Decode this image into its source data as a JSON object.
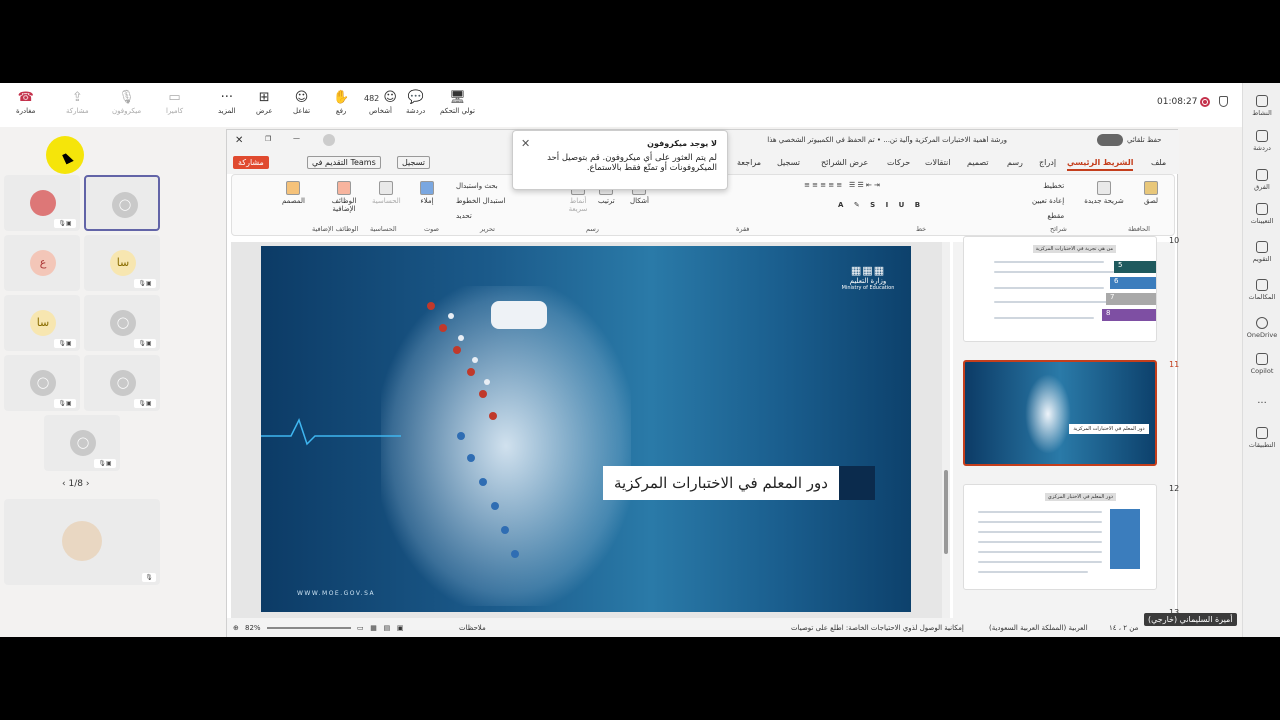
{
  "teams": {
    "toolbar": {
      "leave": "مغادرة",
      "share": "مشاركة",
      "mic": "ميكروفون",
      "camera": "كاميرا",
      "more": "المزيد",
      "view": "عرض",
      "react": "تفاعل",
      "raise": "رفع",
      "people_count": "482",
      "people": "أشخاص",
      "chat": "دردشة",
      "take_control": "تولي التحكم",
      "timer": "01:08:27"
    },
    "rail": [
      "النشاط",
      "دردشة",
      "الفرق",
      "التعيينات",
      "التقويم",
      "المكالمات",
      "OneDrive",
      "Copilot",
      "...",
      "التطبيقات"
    ],
    "participants": [
      {
        "initials": "",
        "mic": "🎙▣"
      },
      {
        "initials": "",
        "mic": ""
      },
      {
        "initials": "ع",
        "mic": ""
      },
      {
        "initials": "سا",
        "mic": "🎙▣"
      },
      {
        "initials": "سا",
        "mic": "🎙▣"
      },
      {
        "initials": "",
        "mic": "🎙▣"
      },
      {
        "initials": "",
        "mic": "🎙▣"
      },
      {
        "initials": "",
        "mic": "🎙▣"
      },
      {
        "initials": "",
        "mic": "🎙▣"
      }
    ],
    "pager": "1/8",
    "presenter_name": "أميرة السليماني (خارجي)"
  },
  "ppt": {
    "title": "ورشة أهمية الاختبارات المركزية وآلية تن... • تم الحفظ في الكمبيوتر الشخصي هذا",
    "autosave": "حفظ تلقائي",
    "tabs": [
      "ملف",
      "الشريط الرئيسي",
      "إدراج",
      "رسم",
      "تصميم",
      "انتقالات",
      "حركات",
      "عرض الشرائح",
      "تسجيل",
      "مراجعة"
    ],
    "record_btn": "تسجيل",
    "present_teams": "التقديم في Teams",
    "share_btn": "مشاركة",
    "ribbon": {
      "paste": "لصق",
      "clipboard": "الحافظة",
      "new_slide": "شريحة جديدة",
      "layout": "تخطيط",
      "reset": "إعادة تعيين",
      "section": "مقطع",
      "slides": "شرائح",
      "font": "خط",
      "paragraph": "فقرة",
      "shapes": "أشكال",
      "arrange": "ترتيب",
      "quick_styles": "أنماط سريعة",
      "drawing": "رسم",
      "find": "بحث واستبدال",
      "replace_fonts": "استبدال الخطوط",
      "select": "تحديد",
      "editing": "تحرير",
      "dictate": "إملاء",
      "voice": "صوت",
      "sensitivity": "الحساسية",
      "addins": "الوظائف الإضافية",
      "designer": "المصمم"
    },
    "slide": {
      "title": "دور المعلم في الاختبارات المركزية",
      "ministry_ar": "وزارة التعليم",
      "ministry_en": "Ministry of Education",
      "url": "WWW.MOE.GOV.SA"
    },
    "thumbs": [
      {
        "num": "10",
        "title": "من هي تجربة في الاختبارات المركزية"
      },
      {
        "num": "11",
        "title": "دور المعلم في الاختبارات المركزية"
      },
      {
        "num": "12",
        "title": "دور المعلم في الاختبار المركزي"
      },
      {
        "num": "13",
        "title": ""
      }
    ],
    "status": {
      "slide_num": "من ٢ ، ١٤",
      "lang": "العربية (المملكة العربية السعودية)",
      "accessibility": "إمكانية الوصول لذوي الاحتياجات الخاصة: اطلع على توصيات",
      "notes": "ملاحظات",
      "zoom": "82%"
    }
  },
  "notification": {
    "title": "لا يوجد ميكروفون",
    "body": "لم يتم العثور على أي ميكروفون. قم بتوصيل أحد الميكروفونات أو تمتّع فقط بالاستماع."
  },
  "colors": {
    "accent": "#c43e1c",
    "teams": "#6264a7",
    "hangup": "#c4314b"
  }
}
